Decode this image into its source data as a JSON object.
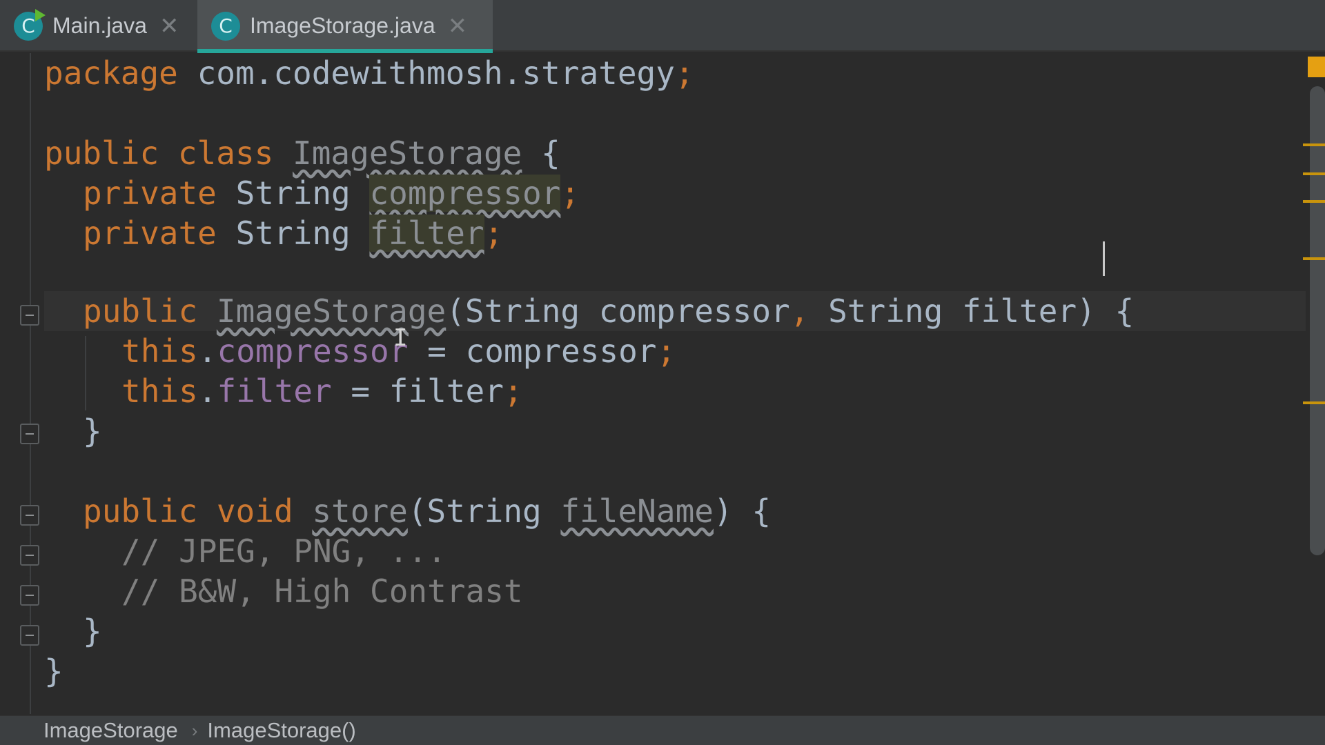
{
  "tabs": [
    {
      "label": "Main.java",
      "icon": "java-class-icon",
      "icon_letter": "C",
      "active": false,
      "runnable": true
    },
    {
      "label": "ImageStorage.java",
      "icon": "java-class-icon",
      "icon_letter": "C",
      "active": true,
      "runnable": false
    }
  ],
  "tab_close_glyph": "✕",
  "code": {
    "l1": {
      "kw": "package",
      "rest": " com.codewithmosh.strategy",
      "semi": ";"
    },
    "l3": {
      "kw1": "public",
      "kw2": " class",
      "name": "ImageStorage",
      "brace": " {"
    },
    "l4": {
      "kw": "private",
      "type": " String ",
      "field": "compressor",
      "semi": ";"
    },
    "l5": {
      "kw": "private",
      "type": " String ",
      "field": "filter",
      "semi": ";"
    },
    "l7": {
      "kw": "public",
      "name": "ImageStorage",
      "p1": "(String compressor",
      "comma": ",",
      "p2": " String filter) {"
    },
    "l8": {
      "kw": "this",
      "dot": ".",
      "field": "compressor",
      "rest": " = compressor",
      "semi": ";"
    },
    "l9": {
      "kw": "this",
      "dot": ".",
      "field": "filter",
      "rest": " = filter",
      "semi": ";"
    },
    "l10": {
      "text": "}"
    },
    "l12": {
      "kw1": "public",
      "kw2": " void",
      "name": "store",
      "p1": "(String ",
      "param": "fileName",
      "p2": ") {"
    },
    "l13": {
      "text": "// JPEG, PNG, ..."
    },
    "l14": {
      "text": "// B&W, High Contrast"
    },
    "l15": {
      "text": "}"
    },
    "l16": {
      "text": "}"
    }
  },
  "breadcrumb": {
    "items": [
      "ImageStorage",
      "ImageStorage()"
    ],
    "separator": "›"
  },
  "colors": {
    "keyword": "#cc7832",
    "field": "#9876aa",
    "comment": "#808080",
    "text": "#a9b7c6",
    "background": "#2b2b2b",
    "tab_accent": "#26a69a",
    "warning": "#e5a012"
  }
}
